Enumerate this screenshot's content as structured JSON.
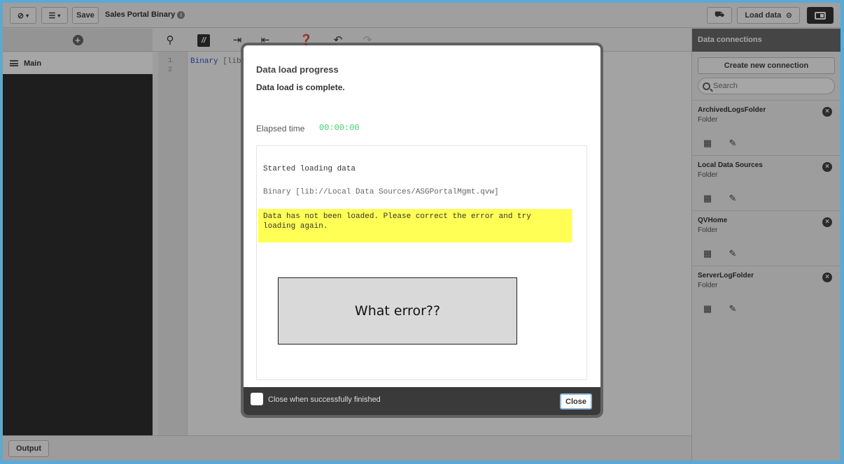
{
  "toolbar": {
    "save_label": "Save",
    "app_title": "Sales Portal Binary",
    "load_data_label": "Load data"
  },
  "left_panel": {
    "section_label": "Main"
  },
  "editor": {
    "line_numbers": [
      "1",
      "2"
    ],
    "code_keyword": "Binary",
    "code_rest": " [lib:"
  },
  "right_panel": {
    "title": "Data connections",
    "create_button": "Create new connection",
    "search_placeholder": "Search",
    "connections": [
      {
        "name": "ArchivedLogsFolder",
        "type": "Folder"
      },
      {
        "name": "Local Data Sources",
        "type": "Folder"
      },
      {
        "name": "QVHome",
        "type": "Folder"
      },
      {
        "name": "ServerLogFolder",
        "type": "Folder"
      }
    ]
  },
  "footer": {
    "output_label": "Output"
  },
  "dialog": {
    "title": "Data load progress",
    "subtitle": "Data load is complete.",
    "elapsed_label": "Elapsed time",
    "elapsed_value": "00:00:00",
    "log_lines": [
      "Started loading data",
      "Binary [lib://Local Data Sources/ASGPortalMgmt.qvw]"
    ],
    "error_text": "Data has not been loaded. Please correct the error and try loading again.",
    "annotation": "What error??",
    "checkbox_label": "Close when successfully finished",
    "close_label": "Close"
  },
  "colors": {
    "frame_border": "#5aa9d6",
    "elapsed": "#3fcf6a",
    "error_highlight": "#ffff55",
    "dark_panel": "#2d2f2d"
  }
}
